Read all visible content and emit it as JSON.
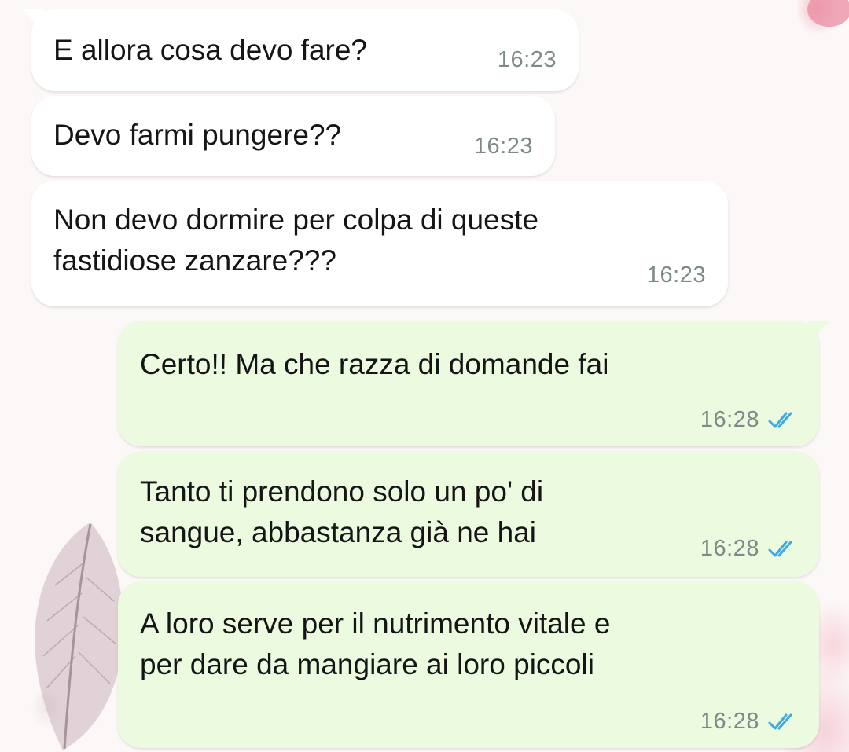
{
  "chat": {
    "messages": [
      {
        "direction": "in",
        "text": "E allora cosa devo fare?",
        "time": "16:23"
      },
      {
        "direction": "in",
        "text": "Devo farmi pungere??",
        "time": "16:23"
      },
      {
        "direction": "in",
        "text": "Non devo dormire per colpa di queste\nfastidiose zanzare???",
        "time": "16:23"
      },
      {
        "direction": "out",
        "text": "Certo!! Ma che razza di domande fai",
        "time": "16:28",
        "status": "read"
      },
      {
        "direction": "out",
        "text": "Tanto ti prendono solo un po' di\nsangue, abbastanza già ne hai",
        "time": "16:28",
        "status": "read"
      },
      {
        "direction": "out",
        "text": "A loro serve per il nutrimento vitale e\nper dare da mangiare ai loro piccoli",
        "time": "16:28",
        "status": "read"
      }
    ]
  },
  "icons": {
    "read_receipt": "double-check-icon"
  },
  "colors": {
    "incoming_bubble": "#ffffff",
    "outgoing_bubble": "#ecfbdf",
    "timestamp": "#7d8a87",
    "read_tick": "#3fa9e6",
    "wallpaper_accent": "#ee9fb3"
  }
}
